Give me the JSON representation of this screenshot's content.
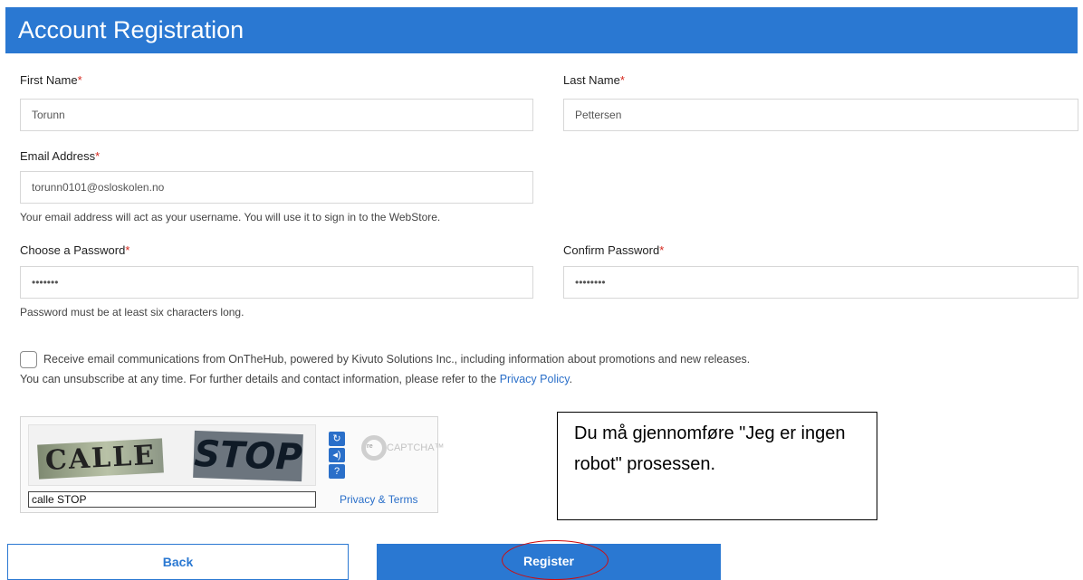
{
  "header": {
    "title": "Account Registration"
  },
  "form": {
    "first_name": {
      "label": "First Name",
      "required_mark": "*",
      "value": "Torunn"
    },
    "last_name": {
      "label": "Last Name",
      "required_mark": "*",
      "value": "Pettersen"
    },
    "email": {
      "label": "Email Address",
      "required_mark": "*",
      "value": "torunn0101@osloskolen.no",
      "hint": "Your email address will act as your username. You will use it to sign in to the WebStore."
    },
    "password": {
      "label": "Choose a Password",
      "required_mark": "*",
      "value": "•••••••",
      "hint": "Password must be at least six characters long."
    },
    "confirm_password": {
      "label": "Confirm Password",
      "required_mark": "*",
      "value": "••••••••"
    }
  },
  "consent": {
    "line1": "Receive email communications from OnTheHub, powered by Kivuto Solutions Inc., including information about promotions and new releases.",
    "line2_prefix": "You can unsubscribe at any time. For further details and contact information, please refer to the ",
    "privacy_link": "Privacy Policy",
    "line2_suffix": "."
  },
  "captcha": {
    "word1": "CALLE",
    "word2": "STOP",
    "input_value": "calle STOP",
    "refresh_icon": "refresh-icon",
    "audio_icon": "audio-icon",
    "help_icon": "help-icon",
    "refresh_glyph": "↻",
    "audio_glyph": "◂)",
    "help_glyph": "?",
    "logo_re": "re",
    "logo_text": "CAPTCHA™",
    "privacy_terms": "Privacy & Terms"
  },
  "note": {
    "text": "Du må gjennomføre \"Jeg er ingen robot\" prosessen."
  },
  "buttons": {
    "back": "Back",
    "register": "Register"
  },
  "colors": {
    "primary": "#2a78d2",
    "required": "#d6261c",
    "annotation": "#d10b0b"
  }
}
